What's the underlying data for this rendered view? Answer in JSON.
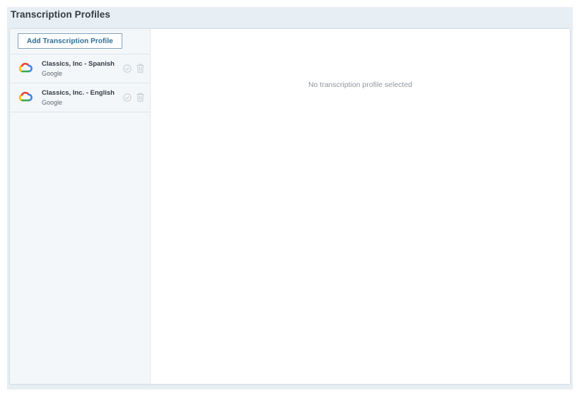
{
  "page": {
    "title": "Transcription Profiles"
  },
  "sidebar": {
    "add_button_label": "Add Transcription Profile",
    "items": [
      {
        "name": "Classics, Inc - Spanish",
        "provider": "Google",
        "icon": "google-cloud-icon"
      },
      {
        "name": "Classics, Inc. - English",
        "provider": "Google",
        "icon": "google-cloud-icon"
      }
    ]
  },
  "main": {
    "empty_message": "No transcription profile selected"
  },
  "colors": {
    "page_background": "#e7eef4",
    "sidebar_background": "#f4f7f9",
    "button_text": "#2e6b93",
    "google_blue": "#4285f4",
    "google_red": "#ea4335",
    "google_yellow": "#fbbc05",
    "google_green": "#34a853"
  }
}
